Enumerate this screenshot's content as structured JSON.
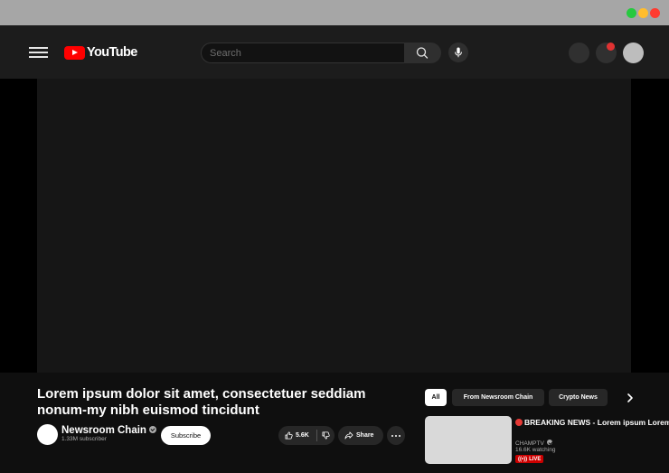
{
  "window": {
    "controls": [
      {
        "name": "minimize",
        "color": "#27c93f"
      },
      {
        "name": "maximize",
        "color": "#ffbd2e"
      },
      {
        "name": "close",
        "color": "#ff3b30"
      }
    ]
  },
  "header": {
    "menu_icon": "hamburger-menu-icon",
    "logo_text": "YouTube",
    "search_placeholder": "Search",
    "search_icon": "search-icon",
    "mic_icon": "microphone-icon",
    "notification_indicator_color": "#e03232"
  },
  "video": {
    "title": "Lorem ipsum dolor sit amet, consectetuer seddiam nonum-my nibh euismod tincidunt",
    "channel_name": "Newsroom Chain",
    "subscribers": "1.33M subscriber",
    "subscribe_label": "Subscribe",
    "likes": "5.6K",
    "share_label": "Share"
  },
  "chips": [
    {
      "label": "All",
      "active": true
    },
    {
      "label": "From Newsroom Chain",
      "active": false
    },
    {
      "label": "Crypto News",
      "active": false
    }
  ],
  "recommendations": [
    {
      "title": "BREAKING NEWS - Lorem ipsum Lorem ipsum dolor sit amet, consec",
      "channel": "CHAMPTV",
      "watching": "16.6K watching",
      "badge": "LIVE"
    }
  ]
}
